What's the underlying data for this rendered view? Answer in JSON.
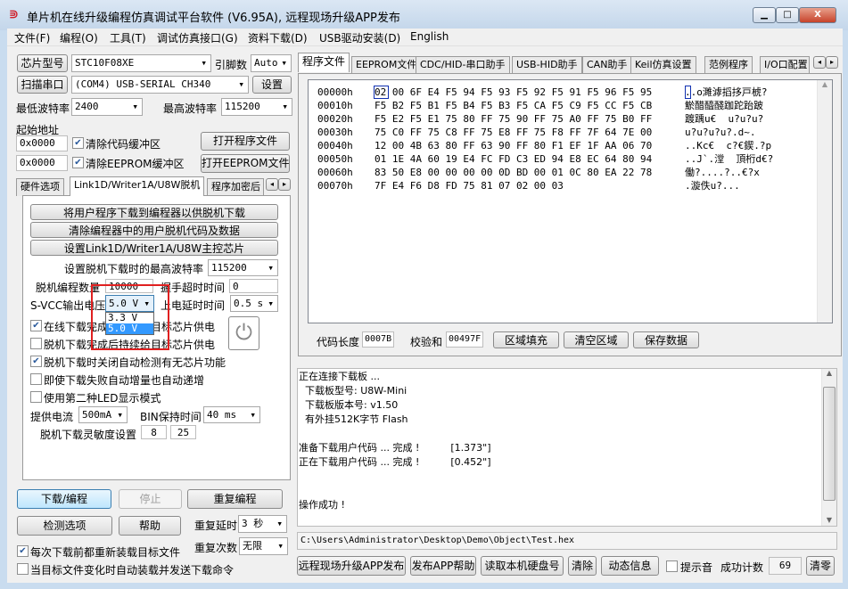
{
  "window": {
    "title": "单片机在线升级编程仿真调试平台软件 (V6.95A), 远程现场升级APP发布",
    "icon": "app-logo-icon",
    "minimize": "▁",
    "maximize": "□",
    "close": "X"
  },
  "menu": [
    "文件(F)",
    "编程(O)",
    "工具(T)",
    "调试仿真接口(G)",
    "资料下载(D)",
    "USB驱动安装(D)",
    "English"
  ],
  "left": {
    "chip_btn": "芯片型号",
    "chip_value": "STC10F08XE",
    "pins_label": "引脚数",
    "pins_value": "Auto",
    "scan_btn": "扫描串口",
    "port_value": "(COM4) USB-SERIAL CH340",
    "settings_btn": "设置",
    "min_baud_label": "最低波特率",
    "min_baud": "2400",
    "max_baud_label": "最高波特率",
    "max_baud": "115200",
    "start_addr_label": "起始地址",
    "addr1": "0x0000",
    "clear_code": "清除代码缓冲区",
    "open_prog": "打开程序文件",
    "addr2": "0x0000",
    "clear_eeprom": "清除EEPROM缓冲区",
    "open_eeprom": "打开EEPROM文件",
    "tabs": [
      "硬件选项",
      "Link1D/Writer1A/U8W脱机",
      "程序加密后"
    ],
    "offline": {
      "btn1": "将用户程序下载到编程器以供脱机下载",
      "btn2": "清除编程器中的用户脱机代码及数据",
      "btn3": "设置Link1D/Writer1A/U8W主控芯片",
      "max_baud_label": "设置脱机下载时的最高波特率",
      "max_baud": "115200",
      "count_label": "脱机编程数量",
      "count": "10000",
      "handshake_label": "握手超时时间",
      "handshake": "0",
      "svcc_label": "S-VCC输出电压",
      "svcc": "5.0 V",
      "svcc_options": [
        "3.3 V",
        "5.0 V"
      ],
      "power_delay_label": "上电延时时间",
      "power_delay": "0.5 s",
      "cb1": "在线下载完成后持续给目标芯片供电",
      "cb2": "脱机下载完成后持续给目标芯片供电",
      "cb3": "脱机下载时关闭自动检测有无芯片功能",
      "cb4": "即使下载失败自动增量也自动递增",
      "cb5": "使用第二种LED显示模式",
      "current_label": "提供电流",
      "current": "500mA",
      "bin_label": "BIN保持时间",
      "bin": "40 ms",
      "sens_label": "脱机下载灵敏度设置",
      "sens1": "8",
      "sens2": "25"
    },
    "download_btn": "下载/编程",
    "stop_btn": "停止",
    "repeat_btn": "重复编程",
    "check_btn": "检测选项",
    "help_btn": "帮助",
    "repeat_delay_label": "重复延时",
    "repeat_delay": "3 秒",
    "repeat_count_label": "重复次数",
    "repeat_count": "无限",
    "reload_cb": "每次下载前都重新装载目标文件",
    "auto_cb": "当目标文件变化时自动装载并发送下载命令"
  },
  "right": {
    "tabs": [
      "程序文件",
      "EEPROM文件",
      "CDC/HID-串口助手",
      "USB-HID助手",
      "CAN助手",
      "Keil仿真设置",
      "范例程序",
      "I/O口配置"
    ],
    "hex": [
      {
        "addr": "00000h",
        "bytes": "02 00 6F E4 F5 94 F5 93 F5 92 F5 91 F5 96 F5 95",
        "ascii": "..o濉滹搯拸戸椃?"
      },
      {
        "addr": "00010h",
        "bytes": "F5 B2 F5 B1 F5 B4 F5 B3 F5 CA F5 C9 F5 CC F5 CB",
        "ascii": "鯲醋醯醆跏跎跆跛"
      },
      {
        "addr": "00020h",
        "bytes": "F5 E2 F5 E1 75 80 FF 75 90 FF 75 A0 FF 75 B0 FF",
        "ascii": "踱踽u€  u?u?u?"
      },
      {
        "addr": "00030h",
        "bytes": "75 C0 FF 75 C8 FF 75 E8 FF 75 F8 FF 7F 64 7E 00",
        "ascii": "u?u?u?u?.d~."
      },
      {
        "addr": "00040h",
        "bytes": "12 00 4B 63 80 FF 63 90 FF 80 F1 EF 1F AA 06 70",
        "ascii": "..Kc€  c?€鍥.?p"
      },
      {
        "addr": "00050h",
        "bytes": "01 1E 4A 60 19 E4 FC FD C3 ED 94 E8 EC 64 80 94",
        "ascii": "..J`.漟  頂桁d€?"
      },
      {
        "addr": "00060h",
        "bytes": "83 50 E8 00 00 00 00 0D BD 00 01 0C 80 EA 22 78",
        "ascii": "働?....?..€?x"
      },
      {
        "addr": "00070h",
        "bytes": "7F E4 F6 D8 FD 75 81 07 02 00 03",
        "ascii": ".漩佚u?..."
      }
    ],
    "code_len_label": "代码长度",
    "code_len": "0007B",
    "checksum_label": "校验和",
    "checksum": "00497F",
    "fill_btn": "区域填充",
    "clear_btn": "清空区域",
    "save_btn": "保存数据",
    "log": [
      "正在连接下载板 ...",
      "  下载板型号: U8W-Mini",
      "  下载板版本号: v1.50",
      "  有外挂512K字节 Flash",
      "",
      "准备下载用户代码 ... 完成 !          [1.373\"]",
      "正在下载用户代码 ... 完成 !          [0.452\"]",
      "",
      "",
      "操作成功 !"
    ],
    "file_path": "C:\\Users\\Administrator\\Desktop\\Demo\\Object\\Test.hex",
    "bottom": {
      "publish": "远程现场升级APP发布",
      "publish_help": "发布APP帮助",
      "read_disk": "读取本机硬盘号",
      "clear": "清除",
      "dyn_info": "动态信息",
      "beep": "提示音",
      "success_label": "成功计数",
      "success_count": "69",
      "reset": "清零"
    }
  },
  "colors": {
    "highlight": "#3399ff",
    "red_box": "#e02020",
    "titlebar": "#c3d6ea"
  }
}
